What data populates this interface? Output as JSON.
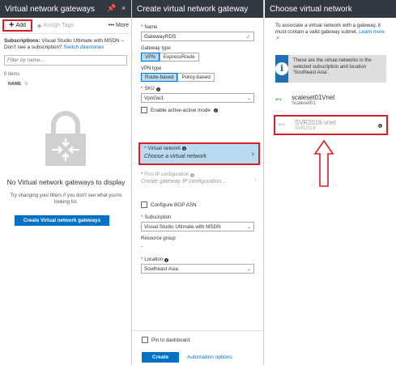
{
  "blade1": {
    "title": "Virtual network gateways",
    "pin_glyph": "📌",
    "close_glyph": "×",
    "toolbar": {
      "add": "Add",
      "assign_tags": "Assign Tags",
      "more": "More"
    },
    "subscriptions_label": "Subscriptions:",
    "subscriptions_value": "Visual Studio Ultimate with MSDN",
    "subscriptions_question": "– Don't see a subscription?",
    "switch_directories": "Switch directories",
    "filter_placeholder": "Filter by name...",
    "items_count": "0 items",
    "column_name": "NAME",
    "empty_title": "No Virtual network gateways to display",
    "empty_sub": "Try changing your filters if you don't see what you're looking for.",
    "create_button": "Create Virtual network gateways"
  },
  "blade2": {
    "title": "Create virtual network gateway",
    "name_label": "Name",
    "name_value": "GatewayRDS",
    "gateway_type_label": "Gateway type",
    "gateway_type_options": [
      "VPN",
      "ExpressRoute"
    ],
    "vpn_type_label": "VPN type",
    "vpn_type_options": [
      "Route-based",
      "Policy-based"
    ],
    "sku_label": "SKU",
    "sku_value": "VpnGw1",
    "active_active_label": "Enable active-active mode",
    "vnet_label": "Virtual network",
    "vnet_value": "Choose a virtual network",
    "ip_label": "First IP configuration",
    "ip_value": "Create gateway IP configuration...",
    "bgp_label": "Configure BGP ASN",
    "subscription_label": "Subscription",
    "subscription_value": "Visual Studio Ultimate with MSDN",
    "resource_group_label": "Resource group",
    "resource_group_value": "-",
    "location_label": "Location",
    "location_value": "Southeast Asia",
    "pin_dashboard": "Pin to dashboard",
    "create_button": "Create",
    "automation_options": "Automation options"
  },
  "blade3": {
    "title": "Choose virtual network",
    "description": "To associate a virtual network with a gateway, it must contain a valid gateway subnet.",
    "learn_more": "Learn more",
    "info_text": "These are the virtual networks in the selected subscription and location 'Southeast Asia'.",
    "networks": [
      {
        "name": "scaleset01Vnet",
        "group": "Scaleset01"
      },
      {
        "name": "SVR2016-vnet",
        "group": "SVR2016"
      }
    ]
  },
  "colors": {
    "accent": "#0072c6",
    "highlight": "#d42027",
    "header": "#32383f",
    "selected": "#b9dbf2"
  }
}
